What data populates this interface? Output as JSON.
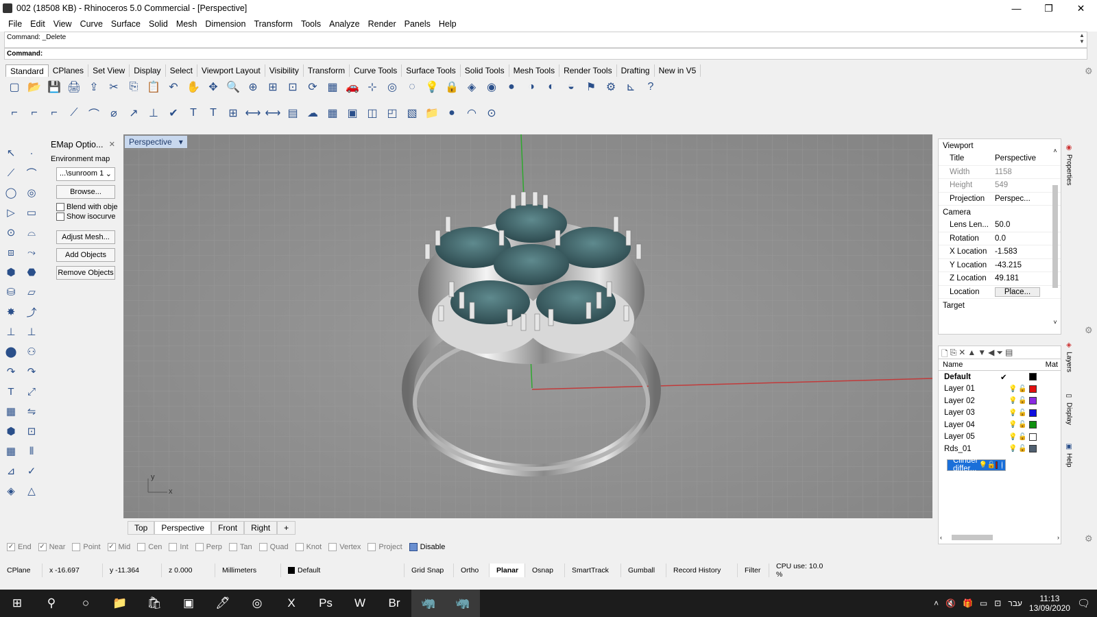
{
  "window": {
    "title": "002 (18508 KB) - Rhinoceros 5.0 Commercial - [Perspective]",
    "min": "—",
    "max": "❐",
    "close": "✕"
  },
  "menu": [
    "File",
    "Edit",
    "View",
    "Curve",
    "Surface",
    "Solid",
    "Mesh",
    "Dimension",
    "Transform",
    "Tools",
    "Analyze",
    "Render",
    "Panels",
    "Help"
  ],
  "command": {
    "history": "Command: _Delete",
    "prompt": "Command:"
  },
  "toolbar_tabs": [
    "Standard",
    "CPlanes",
    "Set View",
    "Display",
    "Select",
    "Viewport Layout",
    "Visibility",
    "Transform",
    "Curve Tools",
    "Surface Tools",
    "Solid Tools",
    "Mesh Tools",
    "Render Tools",
    "Drafting",
    "New in V5"
  ],
  "toolbar1_icons": [
    "new-icon",
    "open-icon",
    "save-icon",
    "print-icon",
    "export-icon",
    "cut-icon",
    "copy-icon",
    "paste-icon",
    "undo-icon",
    "pan-hand-icon",
    "move-view-icon",
    "zoom-icon",
    "zoom-window-icon",
    "zoom-extents-icon",
    "zoom-selected-icon",
    "rotate-view-icon",
    "four-view-icon",
    "car-icon",
    "grid-icon",
    "cplane-icon",
    "point-icon",
    "lightbulb-icon",
    "lock-icon",
    "layer-icon",
    "color-wheel-icon",
    "render-sphere-icon",
    "shade-icon",
    "rendered-icon",
    "material-icon",
    "filter-icon",
    "settings-gear-icon",
    "snap-icon",
    "help-icon"
  ],
  "toolbar1_glyphs": [
    "▢",
    "📂",
    "💾",
    "🖨",
    "⇪",
    "✂",
    "⎘",
    "📋",
    "↶",
    "✋",
    "✥",
    "🔍",
    "⊕",
    "⊞",
    "⊡",
    "⟳",
    "▦",
    "🚗",
    "⊹",
    "◎",
    "◌",
    "💡",
    "🔒",
    "◈",
    "◉",
    "●",
    "◑",
    "◐",
    "◒",
    "⚑",
    "⚙",
    "⊾",
    "?"
  ],
  "toolbar2_icons": [
    "dim-linear-icon",
    "dim-aligned-icon",
    "dim-rotated-icon",
    "dim-angle-icon",
    "dim-radius-icon",
    "dim-diameter-icon",
    "leader-icon",
    "ordinate-icon",
    "check-icon",
    "text-icon",
    "text-bold-icon",
    "annotation-icon",
    "dim-icon",
    "dim-edit-icon",
    "hatch-icon",
    "cloud-icon",
    "hatch-pattern-icon",
    "block-icon",
    "section-icon",
    "box-icon",
    "image-icon",
    "folder-icon",
    "sphere-icon",
    "curve-icon",
    "dot-icon"
  ],
  "toolbar2_glyphs": [
    "⌐",
    "⌐",
    "⌐",
    "⟋",
    "⌒",
    "⌀",
    "↗",
    "⊥",
    "✔",
    "T",
    "T",
    "⊞",
    "⟷",
    "⟷",
    "▤",
    "☁",
    "▦",
    "▣",
    "◫",
    "◰",
    "▧",
    "📁",
    "●",
    "◠",
    "⊙"
  ],
  "left_tools": [
    "↖",
    "·",
    "⟋",
    "⌒",
    "◯",
    "◎",
    "▷",
    "▭",
    "⊙",
    "⌓",
    "⧈",
    "⤳",
    "⬢",
    "⬣",
    "⛁",
    "▱",
    "✸",
    "⤴",
    "⊥",
    "⊥",
    "⬤",
    "⚇",
    "↷",
    "↷",
    "T",
    "⤢",
    "▦",
    "⇋",
    "⬢",
    "⊡",
    "▦",
    "⦀",
    "⊿",
    "✓",
    "◈",
    "△"
  ],
  "emap": {
    "title": "EMap Optio...",
    "close": "✕",
    "env_label": "Environment map",
    "env_value": "...\\sunroom 1",
    "browse": "Browse...",
    "blend": "Blend with obje",
    "isocurve": "Show isocurve",
    "adjust": "Adjust Mesh...",
    "add": "Add Objects",
    "remove": "Remove Objects"
  },
  "viewport": {
    "tab": "Perspective",
    "axis_x": "x",
    "axis_y": "y"
  },
  "view_tabs": [
    "Top",
    "Perspective",
    "Front",
    "Right",
    "+"
  ],
  "osnaps": [
    {
      "label": "End",
      "on": true
    },
    {
      "label": "Near",
      "on": true
    },
    {
      "label": "Point",
      "on": false
    },
    {
      "label": "Mid",
      "on": true
    },
    {
      "label": "Cen",
      "on": false
    },
    {
      "label": "Int",
      "on": false
    },
    {
      "label": "Perp",
      "on": false
    },
    {
      "label": "Tan",
      "on": false
    },
    {
      "label": "Quad",
      "on": false
    },
    {
      "label": "Knot",
      "on": false
    },
    {
      "label": "Vertex",
      "on": false
    },
    {
      "label": "Project",
      "on": false
    },
    {
      "label": "Disable",
      "on": false
    }
  ],
  "status": {
    "cplane": "CPlane",
    "x": "x -16.697",
    "y": "y -11.364",
    "z": "z 0.000",
    "units": "Millimeters",
    "layer": "Default",
    "gridsnap": "Grid Snap",
    "ortho": "Ortho",
    "planar": "Planar",
    "osnap": "Osnap",
    "smarttrack": "SmartTrack",
    "gumball": "Gumball",
    "history": "Record History",
    "filter": "Filter",
    "cpu": "CPU use: 10.0 %"
  },
  "properties": {
    "section": "Viewport",
    "rows": [
      {
        "k": "Title",
        "v": "Perspective",
        "dim": false
      },
      {
        "k": "Width",
        "v": "1158",
        "dim": true
      },
      {
        "k": "Height",
        "v": "549",
        "dim": true
      },
      {
        "k": "Projection",
        "v": "Perspec...",
        "dim": false
      }
    ],
    "camera_section": "Camera",
    "camera": [
      {
        "k": "Lens Len...",
        "v": "50.0"
      },
      {
        "k": "Rotation",
        "v": "0.0"
      },
      {
        "k": "X Location",
        "v": "-1.583"
      },
      {
        "k": "Y Location",
        "v": "-43.215"
      },
      {
        "k": "Z Location",
        "v": "49.181"
      },
      {
        "k": "Location",
        "v": "Place..."
      }
    ],
    "target_section": "Target",
    "side_tabs": [
      "Properties",
      "Layers",
      "Display",
      "Help"
    ]
  },
  "layers": {
    "header_name": "Name",
    "header_mat": "Mat",
    "rows": [
      {
        "name": "Default",
        "color": "#000000",
        "default": true
      },
      {
        "name": "Layer 01",
        "color": "#e01010"
      },
      {
        "name": "Layer 02",
        "color": "#8a2be2"
      },
      {
        "name": "Layer 03",
        "color": "#1010e0"
      },
      {
        "name": "Layer 04",
        "color": "#109010"
      },
      {
        "name": "Layer 05",
        "color": "#ffffff"
      },
      {
        "name": "Rds_01",
        "color": "#506070"
      },
      {
        "name": "Clinder differ...",
        "color": "#e01010",
        "selected": true
      }
    ]
  },
  "taskbar": {
    "apps": [
      "⊞",
      "⚲",
      "○",
      "📁",
      "🛍",
      "▣",
      "🖊",
      "◎",
      "X",
      "Ps",
      "W",
      "Br",
      "🦏",
      "🦏"
    ],
    "lang": "עבר",
    "time": "11:13",
    "date": "13/09/2020"
  }
}
